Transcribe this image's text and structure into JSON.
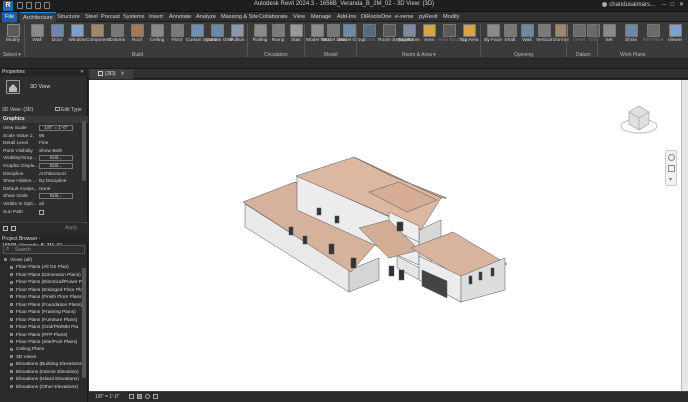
{
  "titlebar": {
    "title": "Autodesk Revit 2024.3 - 1656B_Veranda_B_2M_02 - 3D View: {3D}",
    "user": "chandusaimars..."
  },
  "tabs": [
    "File",
    "Architecture",
    "Structure",
    "Steel",
    "Precast",
    "Systems",
    "Insert",
    "Annotate",
    "Analyze",
    "Massing & Site",
    "Collaborate",
    "View",
    "Manage",
    "Add-Ins",
    "DiRootsOne",
    "e-verse",
    "pyRevit",
    "Modify"
  ],
  "active_tab": "Architecture",
  "ribbon": {
    "select_label": "Select ▾",
    "modify": "Modify",
    "build": [
      "Wall",
      "Door",
      "Window",
      "Component",
      "Column",
      "Roof",
      "Ceiling",
      "Floor",
      "Curtain System",
      "Curtain Grid",
      "Mullion"
    ],
    "circulation": [
      "Railing",
      "Ramp",
      "Stair"
    ],
    "model": [
      "Model Text",
      "Model Line",
      "Model Group"
    ],
    "room": [
      "Room",
      "Room Separator",
      "Tag Room",
      "Area",
      "Area Boundary",
      "Tag Area"
    ],
    "opening": [
      "By Face",
      "Shaft",
      "Wall",
      "Vertical",
      "Dormer"
    ],
    "datum": [
      "Level",
      "Grid"
    ],
    "workplane": [
      "Set",
      "Show",
      "Ref Plane",
      "Viewer"
    ],
    "panels": [
      "Build",
      "Circulation",
      "Model",
      "Room & Area ▾",
      "Opening",
      "Datum",
      "Work Plane"
    ]
  },
  "properties": {
    "header": "Properties",
    "type_name": "3D View",
    "view_selector": "3D View: {3D}",
    "edit_type": "Edit Type",
    "section": "Graphics",
    "rows": [
      {
        "k": "View Scale",
        "v": "1/8\" = 1'-0\"",
        "box": true
      },
      {
        "k": "Scale Value    1:",
        "v": "96",
        "box": false
      },
      {
        "k": "Detail Level",
        "v": "Fine",
        "box": false
      },
      {
        "k": "Parts Visibility",
        "v": "Show Both",
        "box": false
      },
      {
        "k": "Visibility/Grap...",
        "v": "Edit...",
        "box": true
      },
      {
        "k": "Graphic Displa...",
        "v": "Edit...",
        "box": true
      },
      {
        "k": "Discipline",
        "v": "Architectural",
        "box": false
      },
      {
        "k": "Show Hidden ...",
        "v": "By Discipline",
        "box": false
      },
      {
        "k": "Default Analys...",
        "v": "None",
        "box": false
      },
      {
        "k": "Show Grids",
        "v": "Edit...",
        "box": true
      },
      {
        "k": "Visible In Opti...",
        "v": "all",
        "box": false
      },
      {
        "k": "Sun Path",
        "v": "",
        "box": false
      }
    ],
    "apply": "Apply"
  },
  "browser": {
    "header": "Project Browser - 1656B_Veranda_B_2M_02",
    "search_placeholder": "Search",
    "items": [
      "Views (all)",
      "Floor Plans (All On Plan)",
      "Floor Plans (Dimension Plans)",
      "Floor Plans (Electrical/Power Pl",
      "Floor Plans (Enlarged Floor Pla",
      "Floor Plans (Finish Floor Plans)",
      "Floor Plans (Foundation Plans)",
      "Floor Plans (Framing Plans)",
      "Floor Plans (Furniture Plans)",
      "Floor Plans (Grid/PM/Mkt Pla",
      "Floor Plans (PFP Plans)",
      "Floor Plans (Site/Pool Plans)",
      "Ceiling Plans",
      "3D Views",
      "Elevations (Building Elevations",
      "Elevations (Interior Elevation)",
      "Elevations (Island Elevations)",
      "Elevations (Other Elevations)"
    ]
  },
  "view": {
    "tab_label": "{3D}",
    "status_scale": "1/8\" = 1'-0\""
  },
  "colors": {
    "accent": "#1f8ee0",
    "file_tab": "#1f5fa6",
    "roof": "#d8b4a0",
    "wall": "#ececec"
  }
}
